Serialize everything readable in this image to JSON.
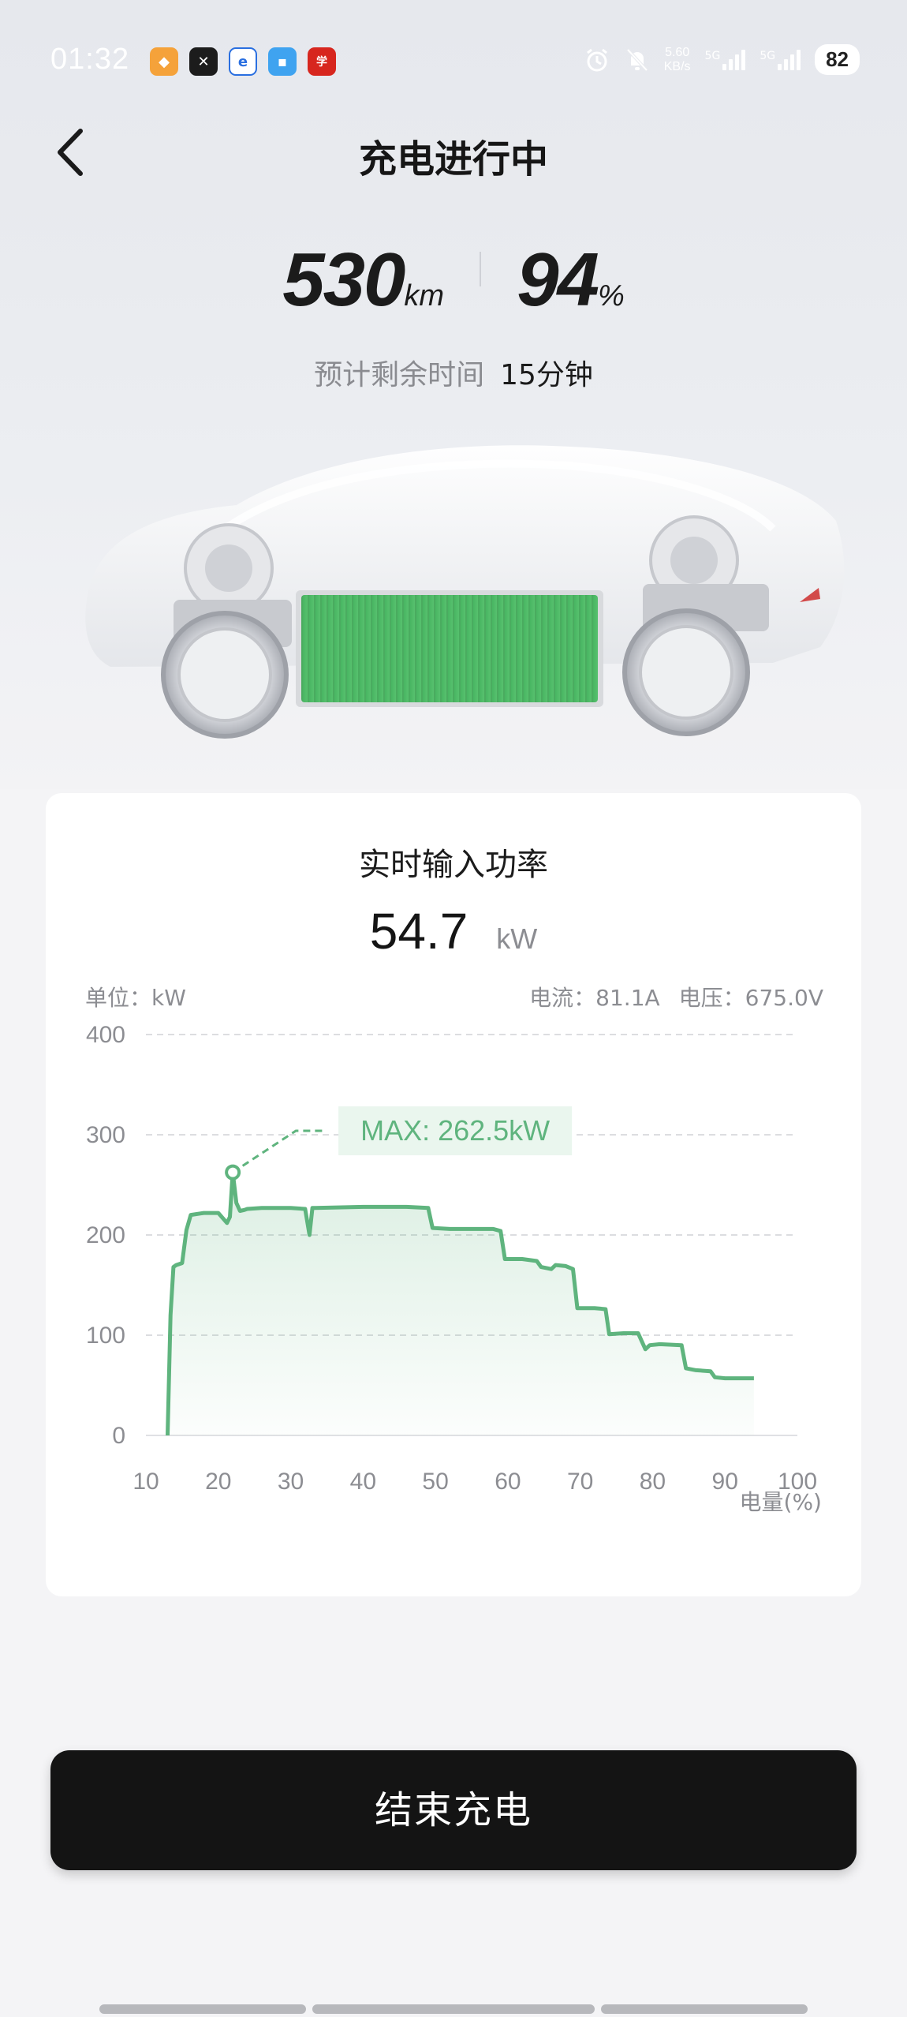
{
  "status_bar": {
    "time": "01:32",
    "net_speed_value": "5.60",
    "net_speed_unit": "KB/s",
    "signal_1": "5G",
    "signal_2": "5G",
    "battery": "82",
    "app_icons": [
      "orange-app-icon",
      "black-x-app-icon",
      "blue-e-app-icon",
      "blue-chat-app-icon",
      "red-news-app-icon"
    ]
  },
  "header": {
    "title": "充电进行中",
    "back_icon": "chevron-left-icon"
  },
  "hero": {
    "range_value": "530",
    "range_unit": "km",
    "soc_value": "94",
    "soc_unit": "%",
    "eta_label": "预计剩余时间",
    "eta_value": "15分钟"
  },
  "power_card": {
    "title": "实时输入功率",
    "power_value": "54.7",
    "power_unit": "kW",
    "unit_label": "单位：kW",
    "current_label": "电流：81.1A",
    "voltage_label": "电压：675.0V",
    "max_label": "MAX: 262.5kW",
    "x_axis_title": "电量(%)"
  },
  "chart_data": {
    "type": "area",
    "xlabel": "电量(%)",
    "ylabel": "",
    "x_ticks": [
      10,
      20,
      30,
      40,
      50,
      60,
      70,
      80,
      90,
      100
    ],
    "y_ticks": [
      0,
      100,
      200,
      300,
      400
    ],
    "xlim": [
      10,
      100
    ],
    "ylim": [
      0,
      400
    ],
    "grid": true,
    "line_color": "#5fb47e",
    "max_point": {
      "x": 22,
      "y": 262.5
    },
    "x": [
      13.0,
      13.4,
      13.8,
      14.2,
      15.0,
      15.6,
      16.2,
      18.0,
      20.0,
      21.2,
      21.6,
      22.0,
      22.5,
      23.0,
      23.6,
      24.0,
      26.0,
      30.0,
      32.0,
      32.6,
      33.0,
      33.4,
      40.0,
      46.0,
      49.0,
      49.6,
      52.0,
      58.0,
      59.0,
      59.6,
      62.0,
      64.0,
      64.6,
      66.0,
      66.6,
      68.0,
      69.0,
      69.6,
      72.0,
      73.5,
      74.0,
      76.0,
      78.0,
      79.0,
      79.6,
      81.0,
      84.0,
      84.6,
      86.0,
      88.0,
      88.6,
      90.0,
      91.0,
      94.0
    ],
    "y": [
      0,
      120,
      168,
      170,
      172,
      205,
      220,
      222,
      222,
      212,
      218,
      262.5,
      232,
      224,
      225,
      226,
      227,
      227,
      226,
      200,
      227,
      227,
      228,
      228,
      227,
      207,
      206,
      206,
      204,
      176,
      176,
      174,
      168,
      166,
      170,
      169,
      166,
      127,
      127,
      126,
      101,
      102,
      102,
      86,
      90,
      91,
      90,
      67,
      65,
      64,
      58,
      57,
      57,
      57
    ]
  },
  "actions": {
    "end_charging": "结束充电"
  }
}
